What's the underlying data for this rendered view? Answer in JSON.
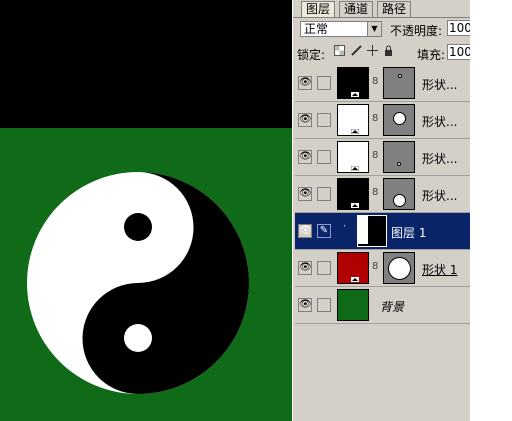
{
  "panel": {
    "tabs": [
      "图层",
      "通道",
      "路径"
    ],
    "active_tab": 0,
    "blend_mode": "正常",
    "opacity_label": "不透明度:",
    "opacity_value": "100",
    "lock_label": "锁定:",
    "fill_label": "填充:",
    "fill_value": "100"
  },
  "layers": [
    {
      "name": "形状...",
      "thumb_color": "#000000",
      "mask": "tiny-dot-top",
      "selected": false
    },
    {
      "name": "形状...",
      "thumb_color": "#ffffff",
      "mask": "medium-dot",
      "selected": false
    },
    {
      "name": "形状...",
      "thumb_color": "#ffffff",
      "mask": "tiny-dot-bottom",
      "selected": false
    },
    {
      "name": "形状...",
      "thumb_color": "#000000",
      "mask": "medium-dot-bottom",
      "selected": false
    },
    {
      "name": "图层 1",
      "thumb_color": "#000000",
      "mask": "none",
      "selected": true
    },
    {
      "name": "形状 1",
      "thumb_color": "#b00000",
      "mask": "large-dot",
      "selected": false
    },
    {
      "name": "背景",
      "thumb_color": "#0f6b18",
      "mask": "none",
      "selected": false
    }
  ],
  "colors": {
    "canvas_top": "#000000",
    "canvas_bg": "#0f6b18",
    "selection": "#0a246a",
    "panel": "#d4d0c8"
  }
}
